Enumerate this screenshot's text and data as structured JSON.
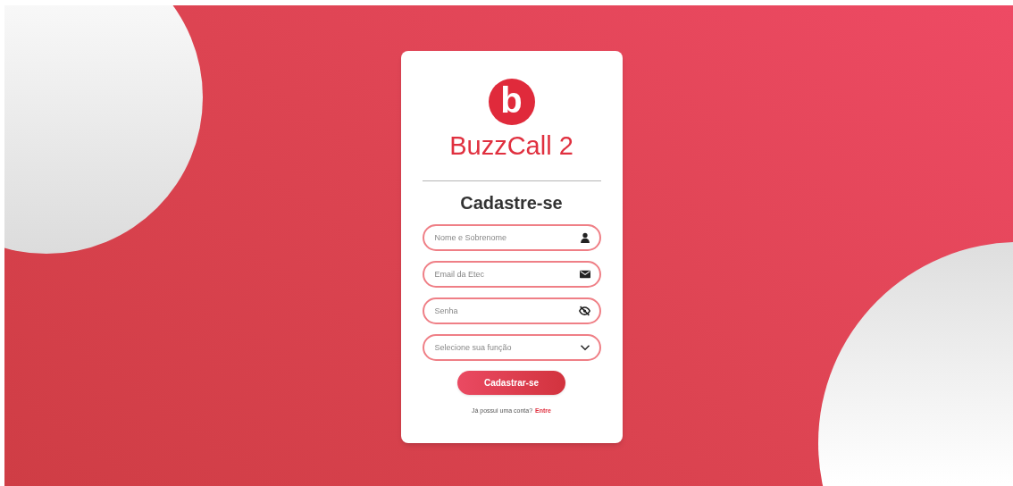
{
  "logo": {
    "letter": "b",
    "name": "BuzzCall 2"
  },
  "heading": "Cadastre-se",
  "fields": [
    {
      "kind": "text",
      "placeholder": "Nome e Sobrenome"
    },
    {
      "kind": "email",
      "placeholder": "Email da Etec"
    },
    {
      "kind": "password",
      "placeholder": "Senha"
    },
    {
      "kind": "select",
      "placeholder": "Selecione sua função"
    }
  ],
  "submit": "Cadastrar-se",
  "login_prompt": {
    "text": "Já possui uma conta?",
    "link": "Entre"
  }
}
